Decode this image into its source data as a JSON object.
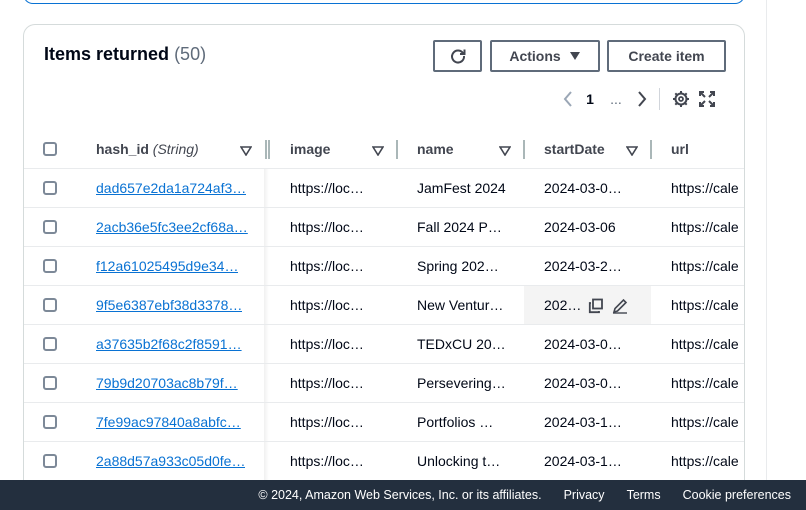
{
  "panel": {
    "title": "Items returned",
    "count": "(50)"
  },
  "toolbar": {
    "refresh_icon": "refresh-icon",
    "actions_label": "Actions",
    "create_label": "Create item"
  },
  "pagination": {
    "current_page": "1",
    "ellipsis": "..."
  },
  "table": {
    "columns": [
      {
        "label": "hash_id",
        "type_hint": "(String)"
      },
      {
        "label": "image"
      },
      {
        "label": "name"
      },
      {
        "label": "startDate"
      },
      {
        "label": "url"
      }
    ],
    "rows": [
      {
        "hash_id": "dad657e2da1a724af3…",
        "image": "https://loc…",
        "name": "JamFest 2024",
        "startDate": "2024-03-0…",
        "url": "https://cale"
      },
      {
        "hash_id": "2acb36e5fc3ee2cf68a…",
        "image": "https://loc…",
        "name": "Fall 2024 P…",
        "startDate": "2024-03-06",
        "url": "https://cale"
      },
      {
        "hash_id": "f12a61025495d9e34…",
        "image": "https://loc…",
        "name": "Spring 202…",
        "startDate": "2024-03-2…",
        "url": "https://cale"
      },
      {
        "hash_id": "9f5e6387ebf38d3378…",
        "image": "https://loc…",
        "name": "New Ventur…",
        "startDate": "202…",
        "url": "https://cale"
      },
      {
        "hash_id": "a37635b2f68c2f8591…",
        "image": "https://loc…",
        "name": "TEDxCU 20…",
        "startDate": "2024-03-0…",
        "url": "https://cale"
      },
      {
        "hash_id": "79b9d20703ac8b79f…",
        "image": "https://loc…",
        "name": "Persevering…",
        "startDate": "2024-03-0…",
        "url": "https://cale"
      },
      {
        "hash_id": "7fe99ac97840a8abfc…",
        "image": "https://loc…",
        "name": "Portfolios …",
        "startDate": "2024-03-1…",
        "url": "https://cale"
      },
      {
        "hash_id": "2a88d57a933c05d0fe…",
        "image": "https://loc…",
        "name": "Unlocking t…",
        "startDate": "2024-03-1…",
        "url": "https://cale"
      }
    ]
  },
  "footer": {
    "copyright": "© 2024, Amazon Web Services, Inc. or its affiliates.",
    "privacy": "Privacy",
    "terms": "Terms",
    "cookies": "Cookie preferences"
  },
  "colors": {
    "link": "#0972d3",
    "footer_bg": "#232f3e",
    "border": "#d5dbdb"
  }
}
